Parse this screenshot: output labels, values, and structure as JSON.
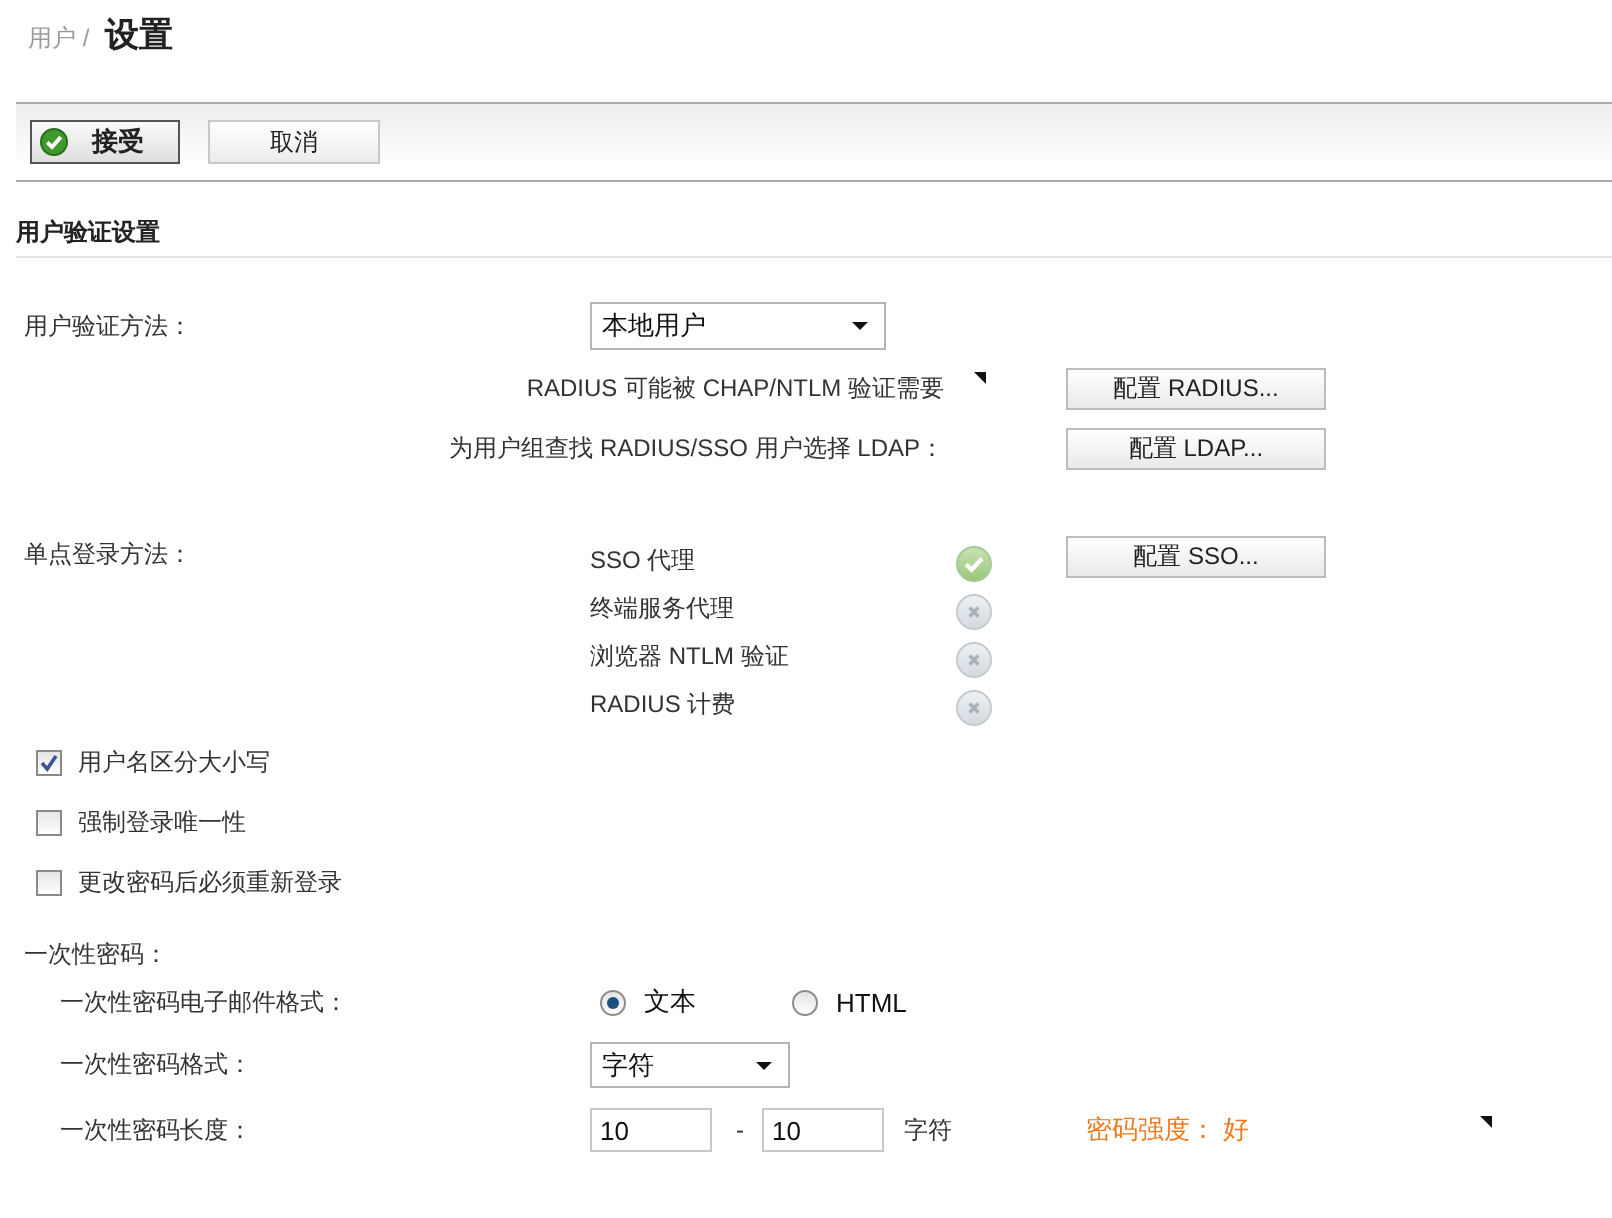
{
  "breadcrumb": {
    "parent": "用户 /",
    "title": "设置"
  },
  "toolbar": {
    "buttons": [
      {
        "label": "接受",
        "kind": "primary"
      },
      {
        "label": "取消",
        "kind": "secondary"
      }
    ]
  },
  "section": {
    "title": "用户验证设置"
  },
  "auth_method": {
    "label": "用户验证方法：",
    "value": "本地用户"
  },
  "auth_notes": [
    {
      "text": "RADIUS 可能被 CHAP/NTLM 验证需要",
      "marker": true,
      "button": "配置 RADIUS..."
    },
    {
      "text": "为用户组查找 RADIUS/SSO 用户选择 LDAP：",
      "marker": false,
      "button": "配置 LDAP..."
    }
  ],
  "sso": {
    "label": "单点登录方法：",
    "button": "配置 SSO...",
    "methods": [
      {
        "name": "SSO 代理",
        "enabled": true
      },
      {
        "name": "终端服务代理",
        "enabled": false
      },
      {
        "name": "浏览器 NTLM 验证",
        "enabled": false
      },
      {
        "name": "RADIUS 计费",
        "enabled": false
      }
    ]
  },
  "options": [
    {
      "label": "用户名区分大小写",
      "checked": true
    },
    {
      "label": "强制登录唯一性",
      "checked": false
    },
    {
      "label": "更改密码后必须重新登录",
      "checked": false
    }
  ],
  "otp": {
    "label": "一次性密码：",
    "email_format": {
      "label": "一次性密码电子邮件格式：",
      "options": [
        {
          "label": "文本",
          "selected": true
        },
        {
          "label": "HTML",
          "selected": false
        }
      ]
    },
    "format": {
      "label": "一次性密码格式：",
      "value": "字符"
    },
    "length": {
      "label": "一次性密码长度：",
      "min": "10",
      "separator": "-",
      "max": "10",
      "unit": "字符",
      "strength": "密码强度： 好",
      "marker": true
    }
  }
}
